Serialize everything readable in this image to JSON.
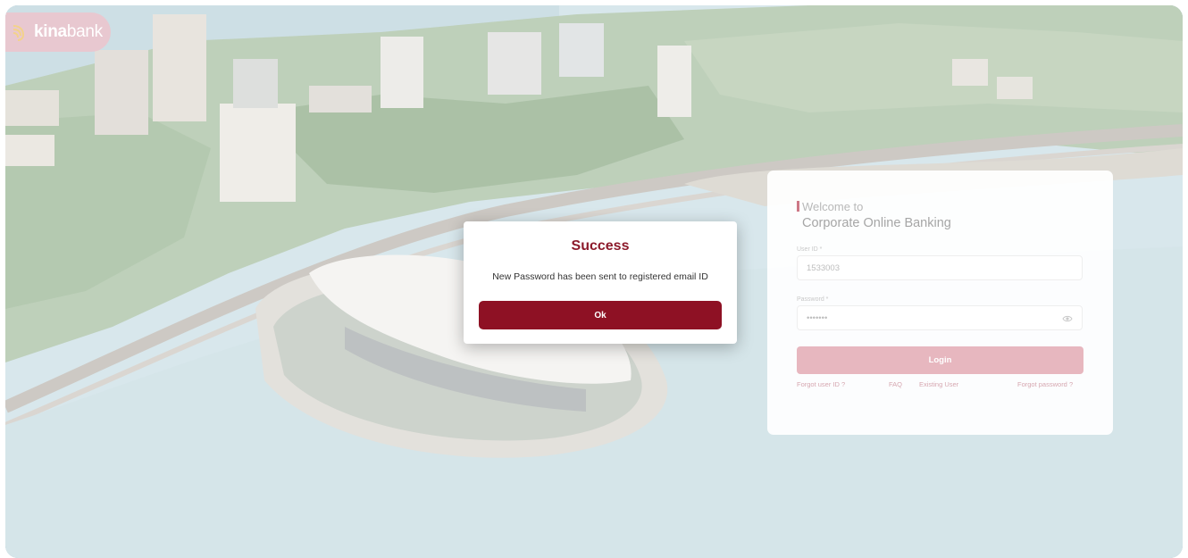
{
  "brand": {
    "name_bold": "kina",
    "name_light": "bank",
    "icon": "kina-logo-icon"
  },
  "dialog": {
    "title": "Success",
    "message": "New Password has been sent to registered email ID",
    "ok_label": "Ok"
  },
  "login": {
    "welcome": "Welcome to",
    "heading": "Corporate Online Banking",
    "user_id_label": "User ID *",
    "user_id_value": "1533003",
    "password_label": "Password *",
    "password_value": "•••••••",
    "password_toggle_icon": "eye-icon",
    "login_label": "Login",
    "links": {
      "forgot_user_id": "Forgot user ID ?",
      "faq": "FAQ",
      "existing_user": "Existing User",
      "forgot_password": "Forgot password ?"
    }
  },
  "colors": {
    "brand_maroon": "#8e1124",
    "brand_pink": "#e7b7bf",
    "title_maroon": "#8c1a2b"
  }
}
